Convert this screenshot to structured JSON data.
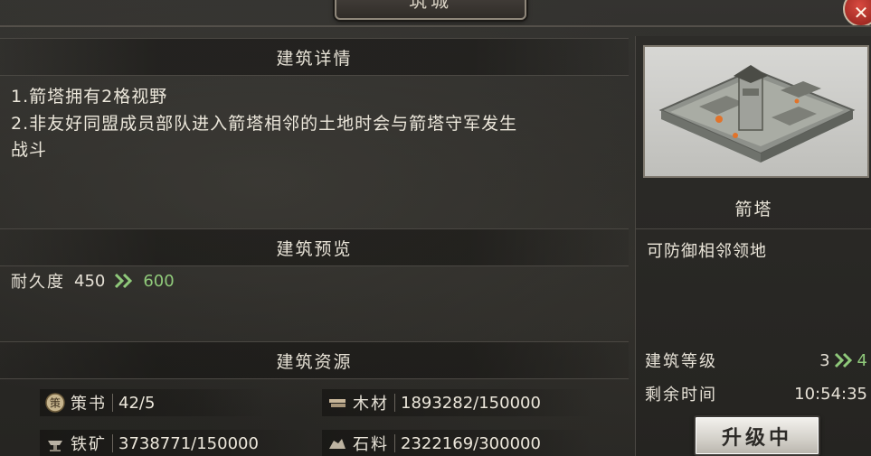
{
  "window": {
    "title": "筑城"
  },
  "sections": {
    "details_title": "建筑详情",
    "preview_title": "建筑预览",
    "resources_title": "建筑资源"
  },
  "details": {
    "line1": "1.箭塔拥有2格视野",
    "line2": "2.非友好同盟成员部队进入箭塔相邻的土地时会与箭塔守军发生",
    "line3": "战斗"
  },
  "preview": {
    "stat_label": "耐久度",
    "from": "450",
    "to": "600"
  },
  "resources": [
    {
      "name": "策书",
      "value": "42/5",
      "icon": "book-icon"
    },
    {
      "name": "木材",
      "value": "1893282/150000",
      "icon": "wood-icon"
    },
    {
      "name": "铁矿",
      "value": "3738771/150000",
      "icon": "iron-icon"
    },
    {
      "name": "石料",
      "value": "2322169/300000",
      "icon": "stone-icon"
    }
  ],
  "building": {
    "name": "箭塔",
    "description": "可防御相邻领地",
    "level_label": "建筑等级",
    "level_from": "3",
    "level_to": "4",
    "time_label": "剩余时间",
    "time_value": "10:54:35",
    "upgrade_label": "升级中"
  },
  "colors": {
    "accent_green": "#8fc97a",
    "close_red": "#c8352c"
  }
}
